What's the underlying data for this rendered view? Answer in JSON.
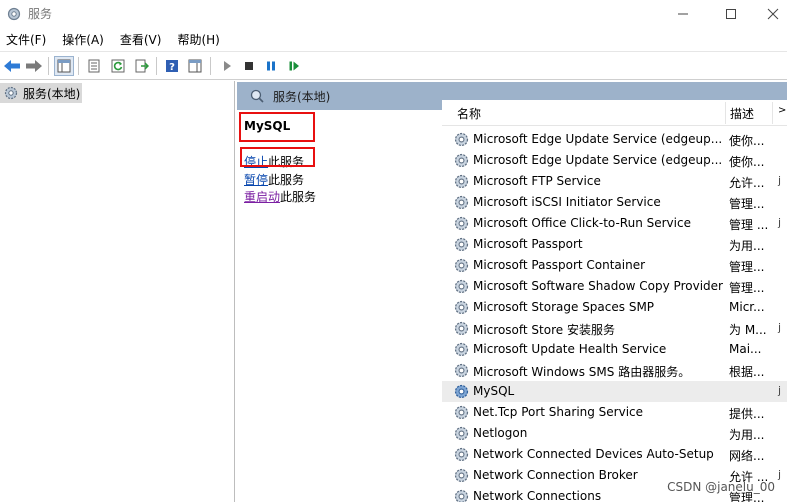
{
  "window": {
    "title": "服务"
  },
  "menu": [
    "文件(F)",
    "操作(A)",
    "查看(V)",
    "帮助(H)"
  ],
  "tree": {
    "root_label": "服务(本地)"
  },
  "header": {
    "label": "服务(本地)"
  },
  "detail": {
    "service_name": "MySQL",
    "stop_link": "停止",
    "stop_suffix": "此服务",
    "pause_link": "暂停",
    "pause_suffix": "此服务",
    "restart_link": "重启动",
    "restart_suffix": "此服务"
  },
  "list": {
    "columns": {
      "name": "名称",
      "description": "描述"
    },
    "rows": [
      {
        "name": "Microsoft Edge Update Service (edgeup...",
        "desc": "使你...",
        "extra": ""
      },
      {
        "name": "Microsoft Edge Update Service (edgeup...",
        "desc": "使你...",
        "extra": ""
      },
      {
        "name": "Microsoft FTP Service",
        "desc": "允许...",
        "extra": "j"
      },
      {
        "name": "Microsoft iSCSI Initiator Service",
        "desc": "管理...",
        "extra": ""
      },
      {
        "name": "Microsoft Office Click-to-Run Service",
        "desc": "管理 ...",
        "extra": "j"
      },
      {
        "name": "Microsoft Passport",
        "desc": "为用...",
        "extra": ""
      },
      {
        "name": "Microsoft Passport Container",
        "desc": "管理...",
        "extra": ""
      },
      {
        "name": "Microsoft Software Shadow Copy Provider",
        "desc": "管理...",
        "extra": ""
      },
      {
        "name": "Microsoft Storage Spaces SMP",
        "desc": "Micr...",
        "extra": ""
      },
      {
        "name": "Microsoft Store 安装服务",
        "desc": "为 M...",
        "extra": "j"
      },
      {
        "name": "Microsoft Update Health Service",
        "desc": "Mai...",
        "extra": ""
      },
      {
        "name": "Microsoft Windows SMS 路由器服务。",
        "desc": "根据...",
        "extra": ""
      },
      {
        "name": "MySQL",
        "desc": "",
        "extra": "j"
      },
      {
        "name": "Net.Tcp Port Sharing Service",
        "desc": "提供...",
        "extra": ""
      },
      {
        "name": "Netlogon",
        "desc": "为用...",
        "extra": ""
      },
      {
        "name": "Network Connected Devices Auto-Setup",
        "desc": "网络...",
        "extra": ""
      },
      {
        "name": "Network Connection Broker",
        "desc": "允许 ...",
        "extra": "j"
      },
      {
        "name": "Network Connections",
        "desc": "管理...",
        "extra": ""
      }
    ]
  },
  "watermark": "CSDN @janelu_00",
  "colors": {
    "header_bg": "#9db2ca",
    "highlight_box": "#e81010",
    "link_blue": "#0645ad",
    "link_purple": "#7b1fa2"
  }
}
